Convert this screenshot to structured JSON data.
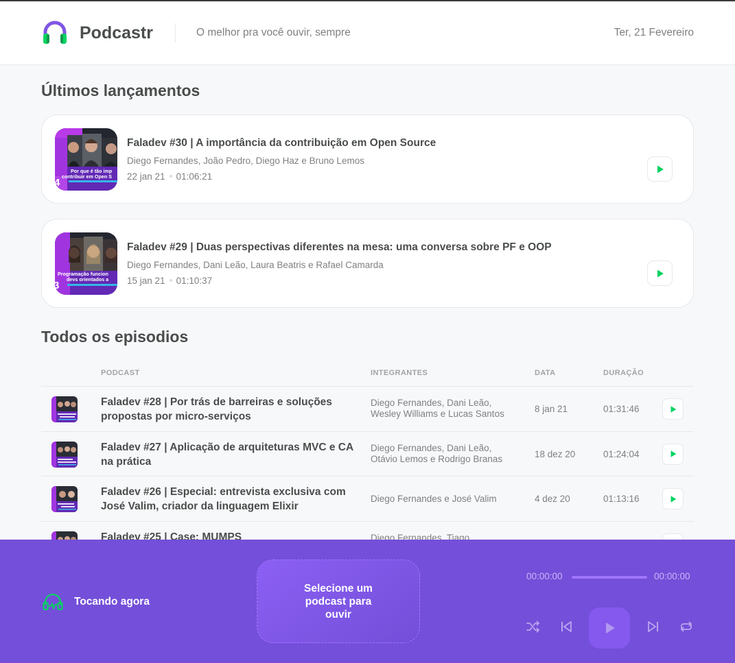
{
  "header": {
    "brand": "Podcastr",
    "tagline": "O melhor pra você ouvir, sempre",
    "date": "Ter, 21 Fevereiro"
  },
  "latest": {
    "title": "Últimos lançamentos",
    "episodes": [
      {
        "title": "Faladev #30 | A importância da contribuição em Open Source",
        "members": "Diego Fernandes, João Pedro, Diego Haz e Bruno Lemos",
        "date": "22 jan 21",
        "duration": "01:06:21",
        "thumb_caption": "Por que é tão imp contribuir em Open S",
        "thumb_number": "4"
      },
      {
        "title": "Faladev #29 | Duas perspectivas diferentes na mesa: uma conversa sobre PF e OOP",
        "members": "Diego Fernandes, Dani Leão, Laura Beatris e Rafael Camarda",
        "date": "15 jan 21",
        "duration": "01:10:37",
        "thumb_caption": "Programação funcion devs orientados a",
        "thumb_number": "3"
      }
    ]
  },
  "all": {
    "title": "Todos os episodios",
    "columns": [
      "PODCAST",
      "INTEGRANTES",
      "DATA",
      "DURAÇÃO"
    ],
    "rows": [
      {
        "title": "Faladev #28 | Por trás de barreiras e soluções propostas por micro-serviços",
        "members": "Diego Fernandes, Dani Leão, Wesley Williams e Lucas Santos",
        "date": "8 jan 21",
        "duration": "01:31:46"
      },
      {
        "title": "Faladev #27 | Aplicação de arquiteturas MVC e CA na prática",
        "members": "Diego Fernandes, Dani Leão, Otávio Lemos e Rodrigo Branas",
        "date": "18 dez 20",
        "duration": "01:24:04"
      },
      {
        "title": "Faladev #26 | Especial: entrevista exclusiva com José Valim, criador da linguagem Elixir",
        "members": "Diego Fernandes e José Valim",
        "date": "4 dez 20",
        "duration": "01:13:16"
      },
      {
        "title": "Faladev #25 | Case: MUMPS",
        "members": "Diego Fernandes, Tiago",
        "date": "",
        "duration": ""
      }
    ]
  },
  "player": {
    "now_playing": "Tocando agora",
    "empty_message": "Selecione um podcast para ouvir",
    "current_time": "00:00:00",
    "total_time": "00:00:00",
    "progress": 0
  },
  "colors": {
    "accent_green": "#04d361",
    "purple": "#8257e5",
    "player_bg": "#744fd9"
  }
}
